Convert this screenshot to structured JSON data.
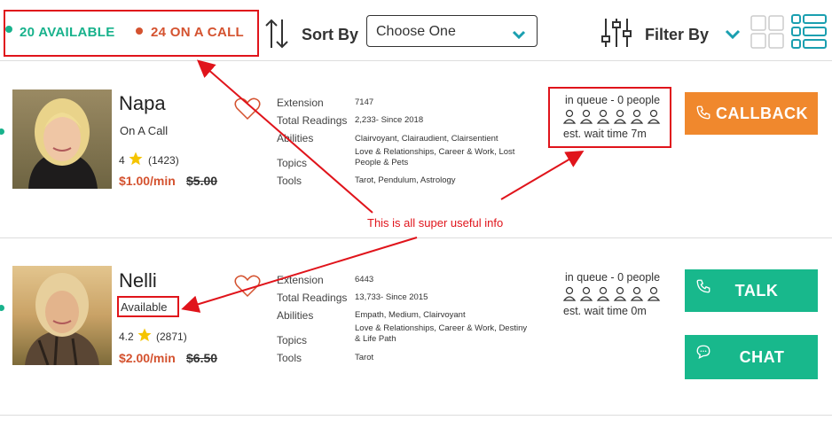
{
  "header": {
    "available_label": "20 AVAILABLE",
    "oncall_label": "24 ON A CALL",
    "sort_label": "Sort By",
    "sort_select_value": "Choose One",
    "filter_label": "Filter By"
  },
  "annotation": {
    "text": "This is all super useful info"
  },
  "detail_labels": {
    "extension": "Extension",
    "total_readings": "Total Readings",
    "abilities": "Abilities",
    "topics": "Topics",
    "tools": "Tools"
  },
  "advisors": [
    {
      "name": "Napa",
      "status": "On A Call",
      "rating": "4",
      "review_count": "(1423)",
      "price": "$1.00/min",
      "old_price": "$5.00",
      "extension": "7147",
      "total_readings": "2,233- Since 2018",
      "abilities": "Clairvoyant, Clairaudient, Clairsentient",
      "topics": "Love & Relationships, Career & Work, Lost People & Pets",
      "tools": "Tarot, Pendulum, Astrology",
      "queue": "in queue - 0 people",
      "wait": "est. wait time 7m",
      "button_label": "CALLBACK"
    },
    {
      "name": "Nelli",
      "status": "Available",
      "rating": "4.2",
      "review_count": "(2871)",
      "price": "$2.00/min",
      "old_price": "$6.50",
      "extension": "6443",
      "total_readings": "13,733- Since 2015",
      "abilities": "Empath, Medium, Clairvoyant",
      "topics": "Love & Relationships, Career & Work, Destiny & Life Path",
      "tools": "Tarot",
      "queue": "in queue - 0 people",
      "wait": "est. wait time 0m",
      "talk_label": "TALK",
      "chat_label": "CHAT"
    }
  ],
  "colors": {
    "available_green": "#18b28c",
    "oncall_orange": "#d4522f",
    "callback_orange": "#f0882d",
    "talk_green": "#18b88c",
    "annotation_red": "#e0141b"
  }
}
